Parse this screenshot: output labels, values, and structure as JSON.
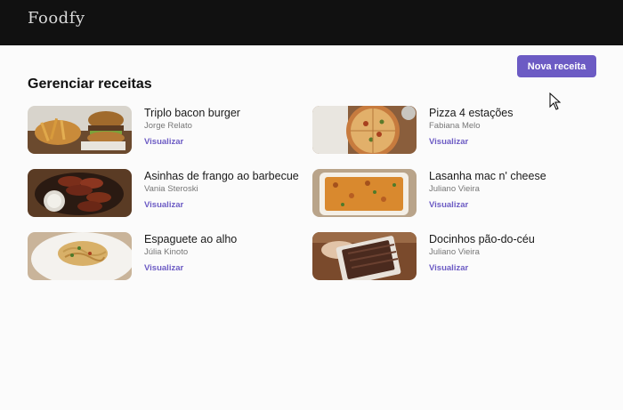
{
  "app": {
    "logo": "Foodfy"
  },
  "header": {
    "new_button_label": "Nova receita"
  },
  "main": {
    "title": "Gerenciar receitas",
    "link_label": "Visualizar",
    "recipes": [
      {
        "title": "Triplo bacon burger",
        "author": "Jorge Relato"
      },
      {
        "title": "Pizza 4 estações",
        "author": "Fabiana Melo"
      },
      {
        "title": "Asinhas de frango ao barbecue",
        "author": "Vania Steroski"
      },
      {
        "title": "Lasanha mac n' cheese",
        "author": "Juliano Vieira"
      },
      {
        "title": "Espaguete ao alho",
        "author": "Júlia Kinoto"
      },
      {
        "title": "Docinhos pão-do-céu",
        "author": "Juliano Vieira"
      }
    ]
  },
  "colors": {
    "accent": "#6c5bc4",
    "topbar": "#111111"
  }
}
